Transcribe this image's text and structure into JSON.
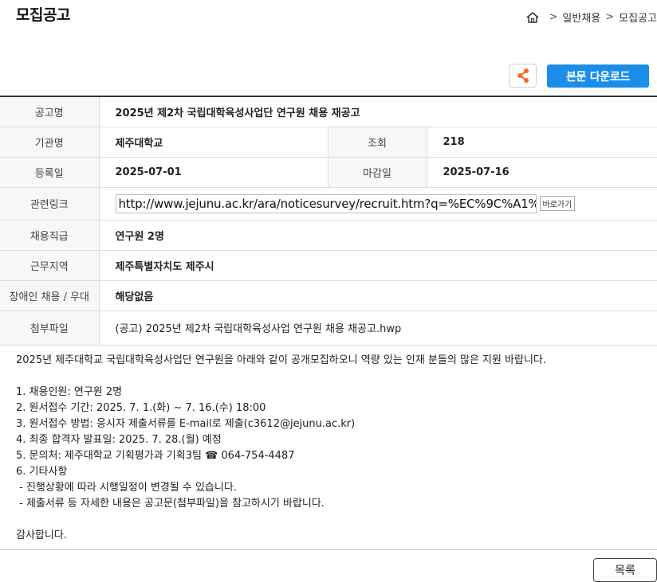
{
  "header": {
    "title": "모집공고",
    "breadcrumb": [
      "일반채용",
      "모집공고"
    ],
    "home_icon": "home-icon"
  },
  "actions": {
    "share_icon": "share-icon",
    "download_label": "본문 다운로드",
    "list_label": "목록"
  },
  "info": {
    "notice_name_label": "공고명",
    "notice_name": "2025년 제2차 국립대학육성사업단 연구원 채용 재공고",
    "org_label": "기관명",
    "org": "제주대학교",
    "views_label": "조회",
    "views": "218",
    "reg_date_label": "등록일",
    "reg_date": "2025-07-01",
    "deadline_label": "마감일",
    "deadline": "2025-07-16",
    "link_label": "관련링크",
    "link": "http://www.jejunu.ac.kr/ara/noticesurvey/recruit.htm?q=%EC%9C%A1%",
    "link_go": "바로가기",
    "rank_label": "채용직급",
    "rank": "연구원 2명",
    "region_label": "근무지역",
    "region": "제주특별자치도 제주시",
    "disability_label": "장애인 채용 / 우대",
    "disability": "해당없음",
    "attachment_label": "첨부파일",
    "attachment": "(공고) 2025년 제2차 국립대학육성사업 연구원 채용 채공고.hwp"
  },
  "body": {
    "lines": [
      "2025년 제주대학교 국립대학육성사업단 연구원을 아래와 같이 공개모집하오니 역량 있는 인재 분들의 많은 지원 바랍니다.",
      "",
      "1. 채용인원: 연구원 2명",
      "2. 원서접수 기간: 2025. 7. 1.(화) ~ 7. 16.(수) 18:00",
      "3. 원서접수 방법: 응시자 제출서류를 E-mail로 제출(c3612@jejunu.ac.kr)",
      "4. 최종 합격자 발표일: 2025. 7. 28.(월) 예정",
      "5. 문의처: 제주대학교 기획평가과 기획3팀 ☎ 064-754-4487",
      "6. 기타사항",
      " - 진행상황에 따라 시행일정이 변경될 수 있습니다.",
      " - 제출서류 등 자세한 내용은 공고문(첨부파일)을 참고하시기 바랍니다.",
      "",
      "감사합니다."
    ]
  },
  "colors": {
    "accent": "#1a8ee8",
    "share": "#f26b2a",
    "label_bg": "#f6f7f9"
  }
}
